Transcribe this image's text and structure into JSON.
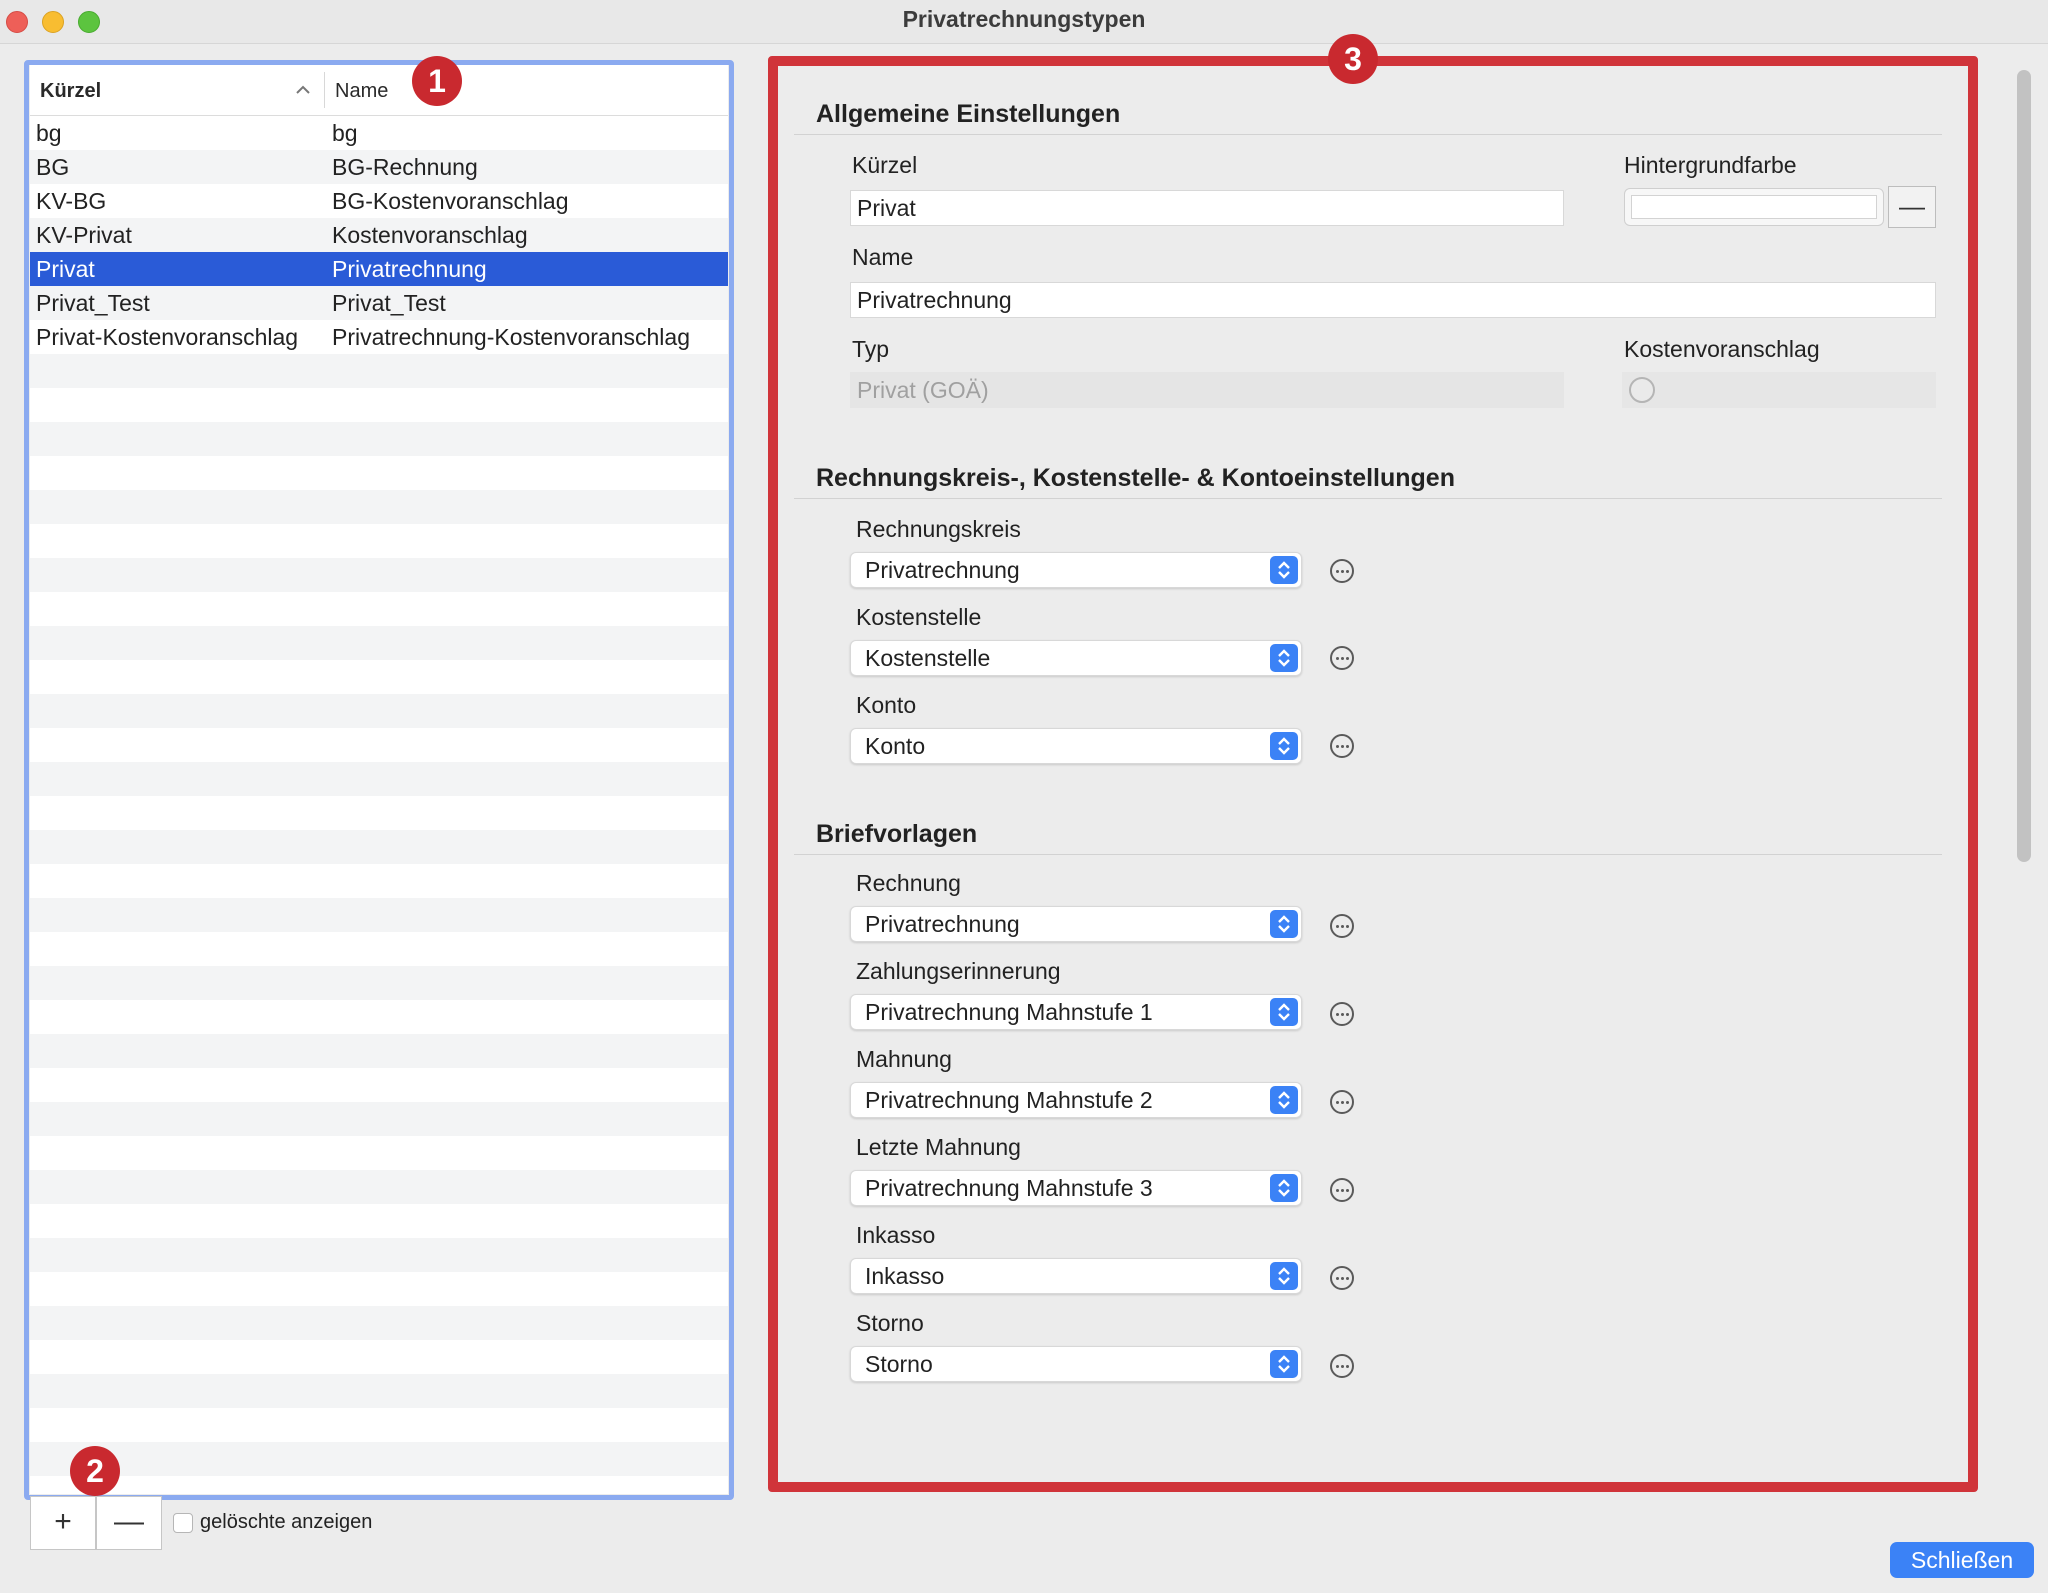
{
  "window": {
    "title": "Privatrechnungstypen"
  },
  "table": {
    "columns": {
      "kuerzel": "Kürzel",
      "name": "Name"
    },
    "rows": [
      {
        "kuerzel": "bg",
        "name": "bg"
      },
      {
        "kuerzel": "BG",
        "name": "BG-Rechnung"
      },
      {
        "kuerzel": "KV-BG",
        "name": "BG-Kostenvoranschlag"
      },
      {
        "kuerzel": "KV-Privat",
        "name": "Kostenvoranschlag"
      },
      {
        "kuerzel": "Privat",
        "name": "Privatrechnung",
        "selected": true
      },
      {
        "kuerzel": "Privat_Test",
        "name": "Privat_Test"
      },
      {
        "kuerzel": "Privat-Kostenvoranschlag",
        "name": "Privatrechnung-Kostenvoranschlag"
      }
    ]
  },
  "footer": {
    "add_label": "+",
    "remove_label": "—",
    "show_deleted_label": "gelöschte anzeigen",
    "close_label": "Schließen"
  },
  "badges": {
    "b1": "1",
    "b2": "2",
    "b3": "3"
  },
  "general": {
    "title": "Allgemeine Einstellungen",
    "kuerzel_label": "Kürzel",
    "kuerzel_value": "Privat",
    "bgcolor_label": "Hintergrundfarbe",
    "bgcolor_remove": "—",
    "name_label": "Name",
    "name_value": "Privatrechnung",
    "typ_label": "Typ",
    "typ_value": "Privat (GOÄ)",
    "kv_label": "Kostenvoranschlag"
  },
  "accounts": {
    "title": "Rechnungskreis-, Kostenstelle- & Kontoeinstellungen",
    "fields": [
      {
        "label": "Rechnungskreis",
        "value": "Privatrechnung"
      },
      {
        "label": "Kostenstelle",
        "value": "Kostenstelle"
      },
      {
        "label": "Konto",
        "value": "Konto"
      }
    ]
  },
  "letters": {
    "title": "Briefvorlagen",
    "fields": [
      {
        "label": "Rechnung",
        "value": "Privatrechnung"
      },
      {
        "label": "Zahlungserinnerung",
        "value": "Privatrechnung Mahnstufe 1"
      },
      {
        "label": "Mahnung",
        "value": "Privatrechnung Mahnstufe 2"
      },
      {
        "label": "Letzte Mahnung",
        "value": "Privatrechnung Mahnstufe 3"
      },
      {
        "label": "Inkasso",
        "value": "Inkasso"
      },
      {
        "label": "Storno",
        "value": "Storno"
      }
    ]
  },
  "colors": {
    "accent": "#3b82f6",
    "selection": "#2a5bd7",
    "highlight_red": "#d0343a",
    "highlight_blue": "#8baaf0"
  }
}
